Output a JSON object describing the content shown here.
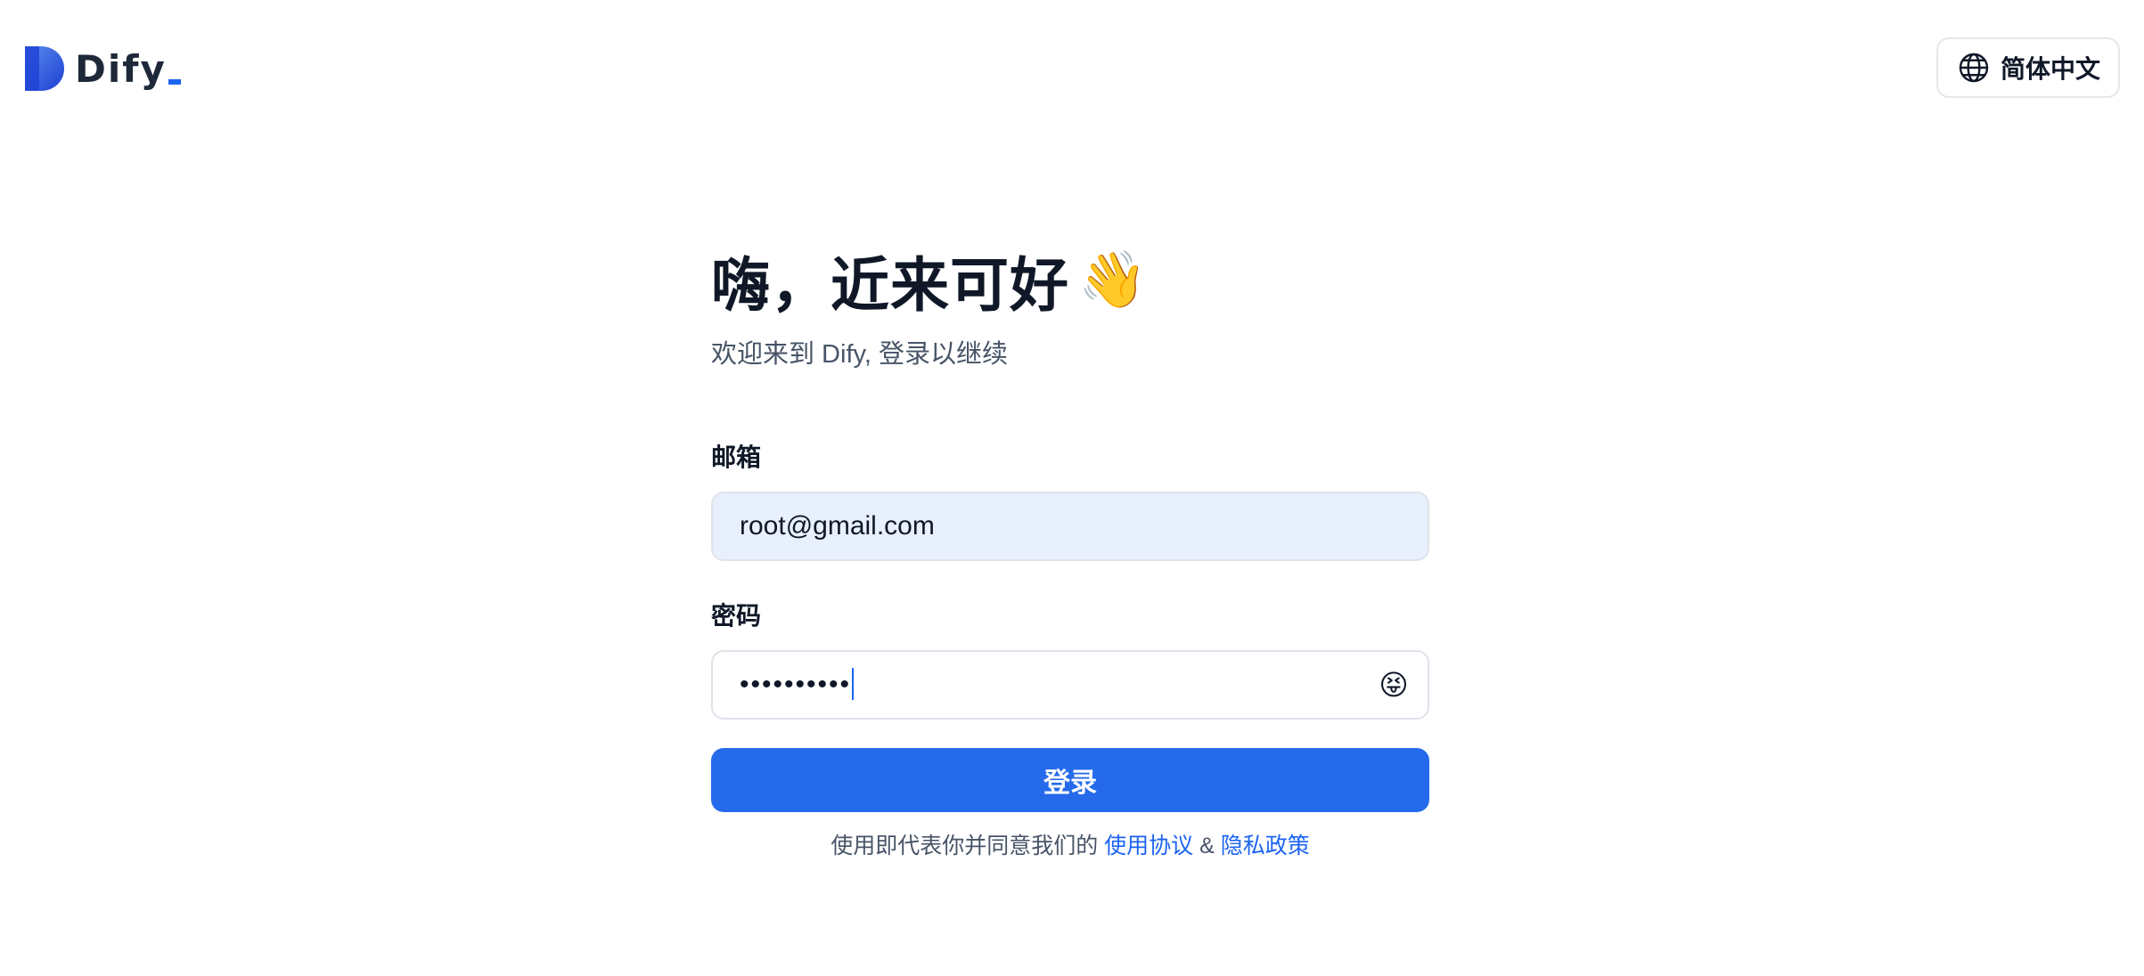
{
  "header": {
    "logo_text": "Dify",
    "language_label": "简体中文"
  },
  "main": {
    "title": "嗨，近来可好",
    "title_emoji": "👋",
    "subtitle": "欢迎来到 Dify, 登录以继续",
    "email_label": "邮箱",
    "email_value": "root@gmail.com",
    "password_label": "密码",
    "password_value": "••••••••••",
    "password_toggle_emoji": "😝",
    "submit_label": "登录",
    "agreement_prefix": "使用即代表你并同意我们的",
    "terms_link": "使用协议",
    "and_text": "&",
    "privacy_link": "隐私政策"
  },
  "colors": {
    "primary": "#256aeb",
    "link": "#1c64f2",
    "autofill_bg": "#e8f0fe",
    "text_dark": "#101828",
    "text_muted": "#475467"
  },
  "icons": {
    "logo": "dify-logo-icon",
    "language": "globe-icon",
    "password_toggle": "eye-toggle-icon"
  }
}
